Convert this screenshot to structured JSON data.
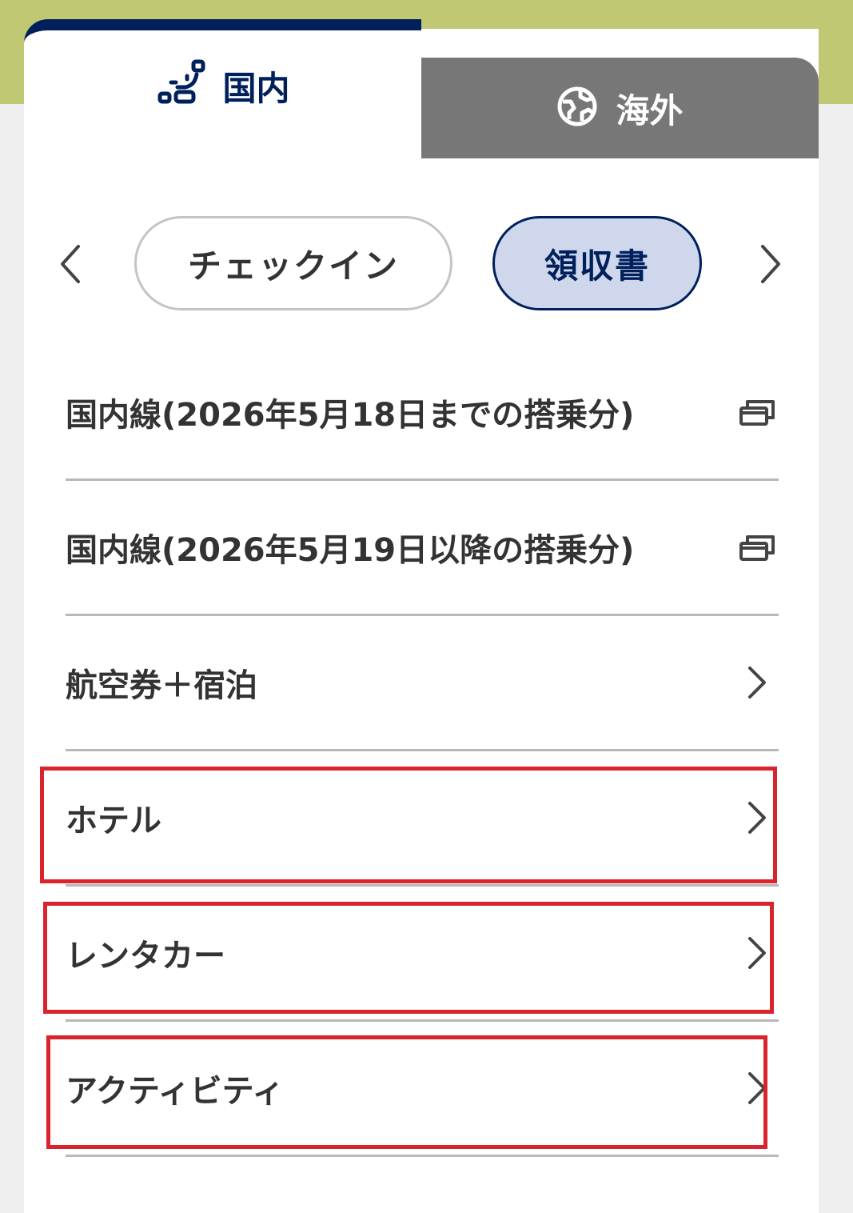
{
  "tabs": {
    "domestic": {
      "label": "国内",
      "icon": "seat-icon",
      "active": true
    },
    "international": {
      "label": "海外",
      "icon": "globe-icon",
      "active": false
    }
  },
  "pills": {
    "checkin": "チェックイン",
    "receipt": "領収書"
  },
  "list": {
    "items": [
      {
        "label": "国内線(2026年5月18日までの搭乗分)",
        "icon": "external-window-icon"
      },
      {
        "label": "国内線(2026年5月19日以降の搭乗分)",
        "icon": "external-window-icon"
      },
      {
        "label": "航空券＋宿泊",
        "icon": "chevron-right-icon"
      },
      {
        "label": "ホテル",
        "icon": "chevron-right-icon",
        "highlighted": true
      },
      {
        "label": "レンタカー",
        "icon": "chevron-right-icon",
        "highlighted": true
      },
      {
        "label": "アクティビティ",
        "icon": "chevron-right-icon",
        "highlighted": true
      }
    ]
  },
  "colors": {
    "brand_navy": "#00205b",
    "header_band": "#c0c873",
    "inactive_tab": "#777777",
    "active_pill_bg": "#cfd7ec",
    "highlight_red": "#d9232d"
  }
}
